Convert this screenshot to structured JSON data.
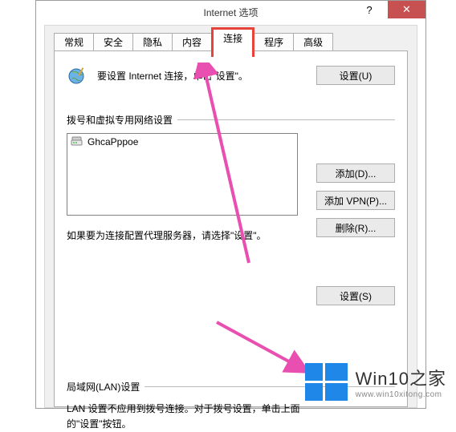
{
  "window": {
    "title": "Internet 选项"
  },
  "tabs": {
    "t0": "常规",
    "t1": "安全",
    "t2": "隐私",
    "t3": "内容",
    "t4": "连接",
    "t5": "程序",
    "t6": "高级"
  },
  "setup": {
    "text": "要设置 Internet 连接，单击\"设置\"。",
    "button": "设置(U)"
  },
  "dialup": {
    "section_label": "拨号和虚拟专用网络设置",
    "list_item": "GhcaPppoe",
    "btn_add": "添加(D)...",
    "btn_addvpn": "添加 VPN(P)...",
    "btn_remove": "删除(R)...",
    "proxy_text": "如果要为连接配置代理服务器，请选择\"设置\"。",
    "btn_settings": "设置(S)"
  },
  "lan": {
    "section_label": "局域网(LAN)设置",
    "text": "LAN 设置不应用到拨号连接。对于拨号设置，单击上面的\"设置\"按钮。"
  },
  "watermark": {
    "main": "Win10之家",
    "sub": "www.win10xitong.com"
  },
  "titlebar_buttons": {
    "help": "?",
    "close": "✕"
  }
}
